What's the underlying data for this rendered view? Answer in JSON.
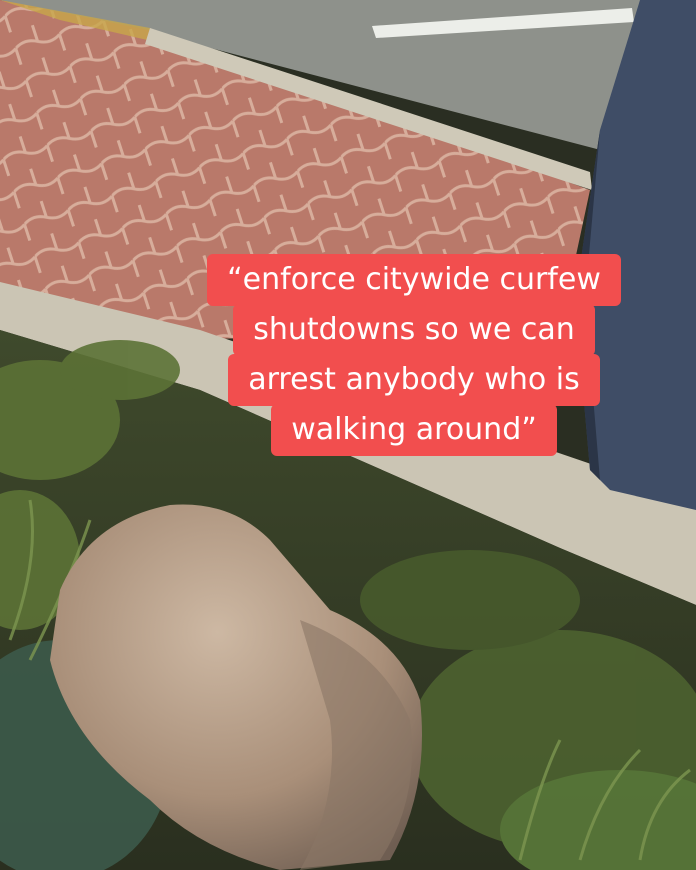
{
  "caption": {
    "lines": [
      "“enforce citywide curfew",
      "shutdowns so we can",
      "arrest anybody who is",
      "walking around”"
    ],
    "background_color": "#f24e4e",
    "text_color": "#ffffff"
  },
  "scene": {
    "colors": {
      "road": "#8c8f88",
      "road_marking": "#e9ece6",
      "pavers": "#b9796a",
      "paver_lines": "#d9b2a0",
      "curb": "#cdc7b7",
      "planter": "#3d4329",
      "foliage": "#5f7338",
      "rock": "#b59c86",
      "dark_panel": "#3e4b63"
    }
  }
}
